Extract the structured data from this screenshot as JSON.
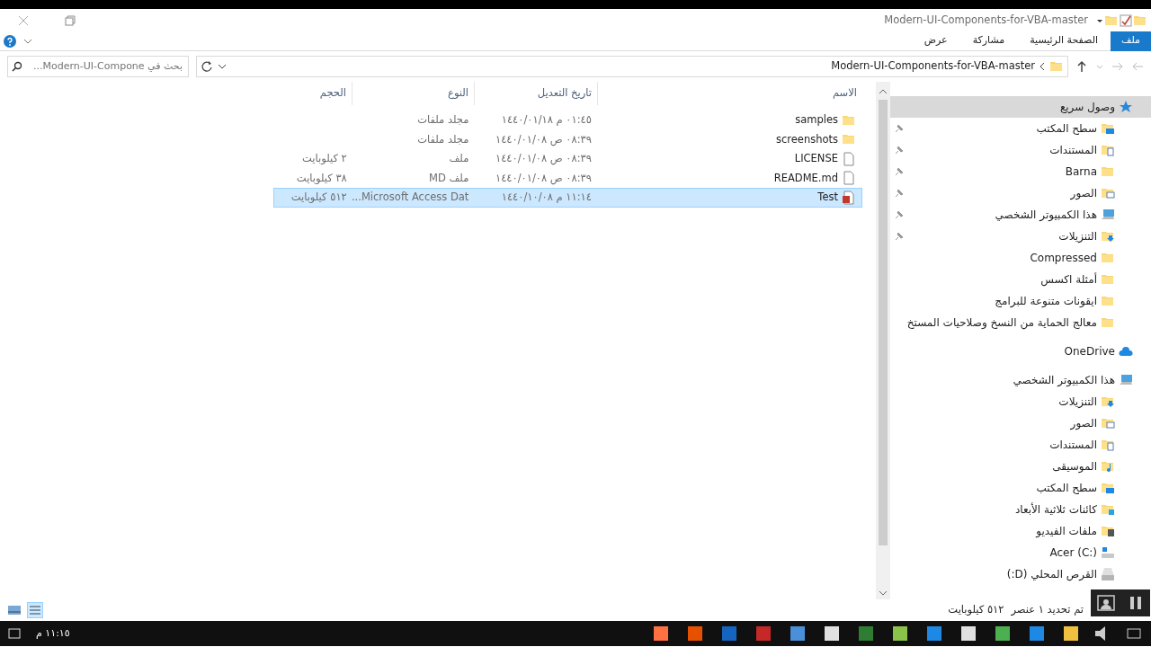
{
  "window": {
    "title": "Modern-UI-Components-for-VBA-master"
  },
  "ribbon_tabs": [
    {
      "label": "ملف",
      "selected": true
    },
    {
      "label": "الصفحة الرئيسية",
      "selected": false
    },
    {
      "label": "مشاركة",
      "selected": false
    },
    {
      "label": "عرض",
      "selected": false
    }
  ],
  "address": {
    "path": "Modern-UI-Components-for-VBA-master"
  },
  "search": {
    "placeholder": "بحث في Modern-UI-Compone..."
  },
  "table": {
    "columns": [
      "الاسم",
      "تاريخ التعديل",
      "النوع",
      "الحجم"
    ],
    "rows": [
      {
        "kind": "folder",
        "name": "samples",
        "modified": "٠١:٤٥ م ١٤٤٠/٠١/١٨",
        "type": "مجلد ملفات",
        "selected": false
      },
      {
        "kind": "folder",
        "name": "screenshots",
        "modified": "٠٨:٣٩ ص ١٤٤٠/٠١/٠٨",
        "type": "مجلد ملفات",
        "selected": false
      },
      {
        "kind": "file",
        "name": "LICENSE",
        "modified": "٠٨:٣٩ ص ١٤٤٠/٠١/٠٨",
        "type": "ملف",
        "size": "٢ كيلوبايت",
        "selected": false
      },
      {
        "kind": "file",
        "name": "README.md",
        "modified": "٠٨:٣٩ ص ١٤٤٠/٠١/٠٨",
        "type": "ملف MD",
        "size": "٣٨ كيلوبايت",
        "selected": false
      },
      {
        "kind": "access",
        "name": "Test",
        "modified": "١١:١٤ م ١٤٤٠/١٠/٠٨",
        "type": "Microsoft Access Dat...",
        "size": "٥١٢ كيلوبايت",
        "selected": true
      }
    ]
  },
  "sidebar": {
    "sections": [
      {
        "label": "وصول سريع",
        "kind": "star",
        "selected": true,
        "items": [
          {
            "label": "سطح المكتب",
            "kind": "desktop",
            "pinned": true
          },
          {
            "label": "المستندات",
            "kind": "documents",
            "pinned": true
          },
          {
            "label": "Barna",
            "kind": "folder",
            "pinned": true
          },
          {
            "label": "الصور",
            "kind": "pictures",
            "pinned": true
          },
          {
            "label": "هذا الكمبيوتر الشخصي",
            "kind": "pc",
            "pinned": true
          },
          {
            "label": "التنزيلات",
            "kind": "downloads",
            "pinned": true
          },
          {
            "label": "Compressed",
            "kind": "folder",
            "pinned": false
          },
          {
            "label": "أمثلة اكسس",
            "kind": "folder",
            "pinned": false
          },
          {
            "label": "ايقونات متنوعة للبرامج",
            "kind": "folder",
            "pinned": false
          },
          {
            "label": "معالج الحماية من النسخ وصلاحيات المستخ",
            "kind": "folder",
            "pinned": false
          }
        ]
      },
      {
        "label": "OneDrive",
        "kind": "cloud",
        "selected": false
      },
      {
        "label": "هذا الكمبيوتر الشخصي",
        "kind": "pc",
        "selected": false,
        "items": [
          {
            "label": "التنزيلات",
            "kind": "downloads",
            "pinned": false
          },
          {
            "label": "الصور",
            "kind": "pictures",
            "pinned": false
          },
          {
            "label": "المستندات",
            "kind": "documents",
            "pinned": false
          },
          {
            "label": "الموسيقى",
            "kind": "music",
            "pinned": false
          },
          {
            "label": "سطح المكتب",
            "kind": "desktop",
            "pinned": false
          },
          {
            "label": "كائنات ثلاثية الأبعاد",
            "kind": "cube",
            "pinned": false
          },
          {
            "label": "ملفات الفيديو",
            "kind": "video",
            "pinned": false
          },
          {
            "label": "Acer (C:)",
            "kind": "windrive",
            "pinned": false
          },
          {
            "label": "القرص المحلي (D:)",
            "kind": "drive",
            "pinned": false
          }
        ]
      }
    ]
  },
  "status_bar": {
    "selection": "تم تحديد ١ عنصر",
    "size": "٥١٢ كيلوبايت"
  },
  "taskbar": {
    "clock": "١١:١٥ م"
  }
}
